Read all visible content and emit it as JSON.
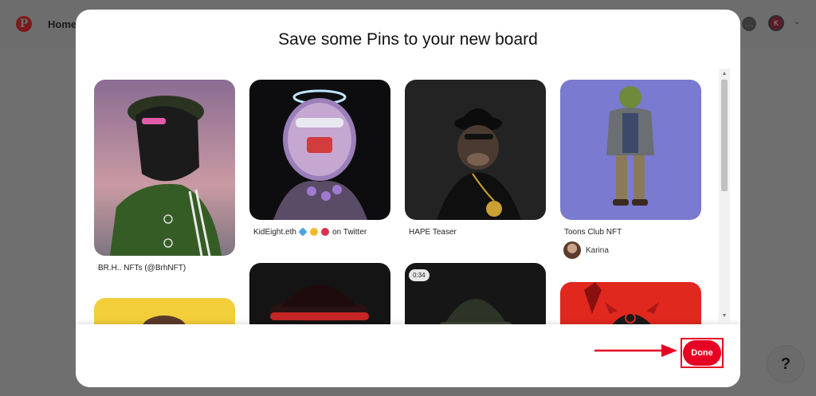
{
  "background": {
    "logo_letter": "P",
    "nav_home": "Home",
    "chat_glyph": "…",
    "avatar_initial": "K",
    "chevron": "⌄",
    "help_label": "?"
  },
  "modal": {
    "title": "Save some Pins to your new board",
    "done_label": "Done",
    "accent_color": "#e60023"
  },
  "pins": [
    {
      "title": "BR.H.. NFTs (@BrhNFT)",
      "description": "green track jacket NFT avatar"
    },
    {
      "title": "KidEight.eth",
      "title_suffix": "on Twitter",
      "description": "neon halo character"
    },
    {
      "title": "HAPE Teaser",
      "description": "ape with hat and gold chain"
    },
    {
      "title": "Toons Club NFT",
      "user": "Karina",
      "description": "cartoon character standing"
    },
    {
      "description": "yellow background character"
    },
    {
      "description": "dark hat with red brim"
    },
    {
      "video_duration": "0:34",
      "description": "soldier helmet"
    },
    {
      "description": "red horned character"
    }
  ]
}
